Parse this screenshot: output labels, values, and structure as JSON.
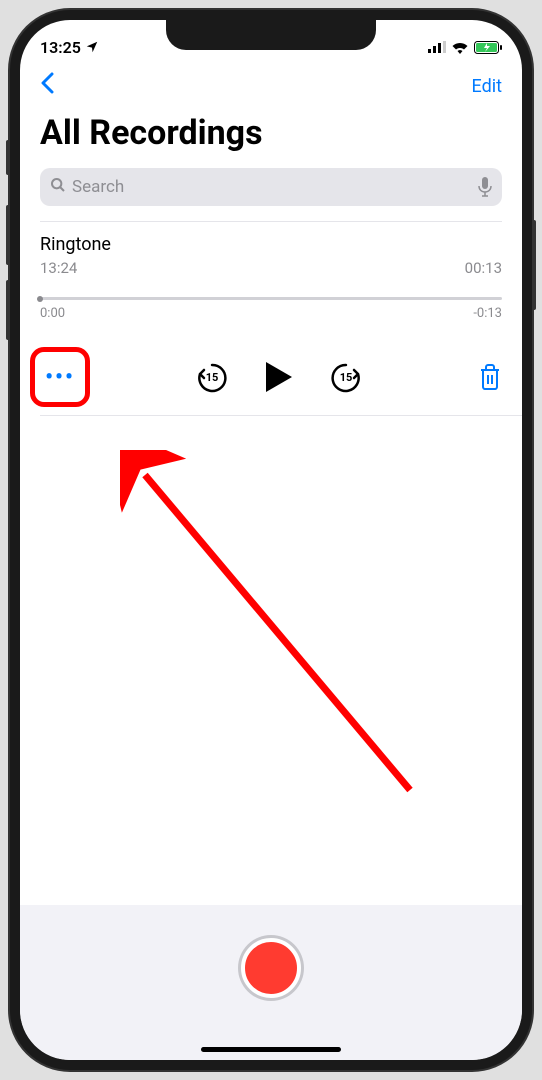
{
  "status_bar": {
    "time": "13:25"
  },
  "nav": {
    "edit": "Edit"
  },
  "page": {
    "title": "All Recordings"
  },
  "search": {
    "placeholder": "Search"
  },
  "recording": {
    "title": "Ringtone",
    "time": "13:24",
    "duration": "00:13",
    "elapsed": "0:00",
    "remaining": "-0:13",
    "skip_seconds": "15"
  }
}
